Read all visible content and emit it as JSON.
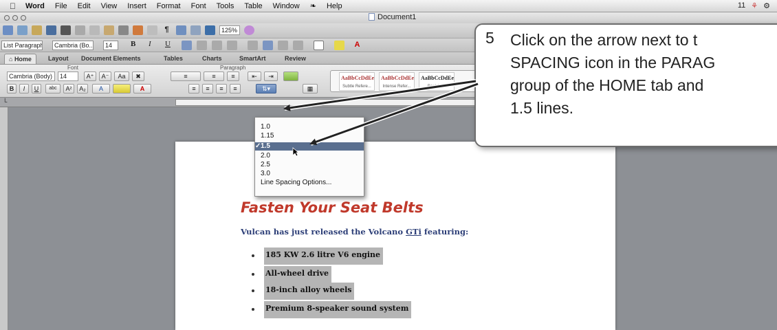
{
  "menubar": {
    "app": "Word",
    "items": [
      "File",
      "Edit",
      "View",
      "Insert",
      "Format",
      "Font",
      "Tools",
      "Table",
      "Window",
      "Help"
    ],
    "status": "11"
  },
  "window": {
    "title": "Document1"
  },
  "toolbar": {
    "zoom": "125%"
  },
  "format_bar": {
    "style": "List Paragraph",
    "font": "Cambria (Bo...",
    "size": "14"
  },
  "ribbon": {
    "tabs": [
      "Home",
      "Layout",
      "Document Elements",
      "Tables",
      "Charts",
      "SmartArt",
      "Review"
    ],
    "groups": {
      "font": "Font",
      "paragraph": "Paragraph"
    },
    "font_name": "Cambria (Body)",
    "font_size": "14",
    "quick_styles": [
      {
        "sample": "AaBbCcDdEe",
        "name": "Subtle Refere..."
      },
      {
        "sample": "AaBbCcDdEe",
        "name": "Intense Refer..."
      },
      {
        "sample": "AaBbCcDdEe",
        "name": "Book Title"
      }
    ]
  },
  "line_spacing_menu": {
    "items": [
      "1.0",
      "1.15",
      "1.5",
      "2.0",
      "2.5",
      "3.0",
      "Line Spacing Options..."
    ],
    "selected": "1.5"
  },
  "document": {
    "heading": "Fasten Your Seat Belts",
    "subheading_pre": "Vulcan has just released the Volcano ",
    "subheading_link": "GTi",
    "subheading_post": " featuring:",
    "bullets": [
      "185 KW 2.6 litre V6 engine",
      "All-wheel drive",
      "18-inch alloy wheels",
      "Premium 8-speaker sound system"
    ]
  },
  "callout": {
    "step": "5",
    "text": "Click on the arrow next to t\nSPACING icon in the PARAG\ngroup of the HOME tab and\n1.5 lines."
  },
  "colors": {
    "heading": "#c0392b",
    "subheading": "#2c3e77",
    "selection": "#b5b5b5",
    "menu_highlight": "#5a6f8f"
  }
}
